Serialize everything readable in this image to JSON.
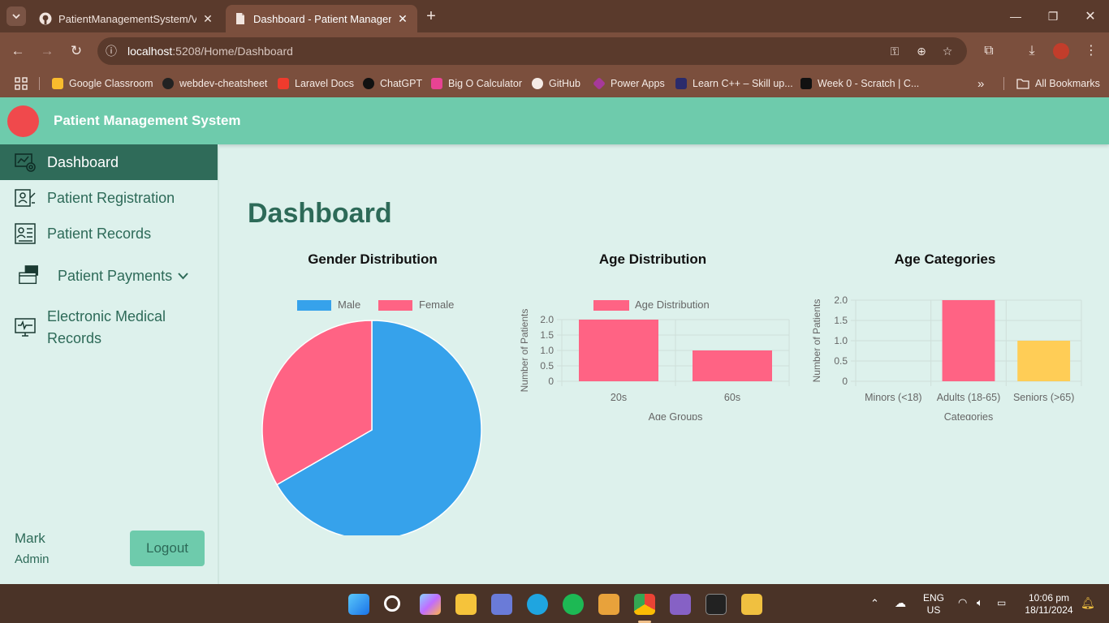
{
  "browser": {
    "tabs": [
      {
        "title": "PatientManagementSystem/Vie",
        "active": false
      },
      {
        "title": "Dashboard - Patient Manageme",
        "active": true
      }
    ],
    "url_host": "localhost",
    "url_path": ":5208/Home/Dashboard",
    "bookmarks": [
      {
        "label": "Google Classroom",
        "color": "#f9bb2d"
      },
      {
        "label": "webdev-cheatsheet",
        "color": "#222222"
      },
      {
        "label": "Laravel Docs",
        "color": "#ef3b2d"
      },
      {
        "label": "ChatGPT",
        "color": "#111111"
      },
      {
        "label": "Big O Calculator",
        "color": "#e84393"
      },
      {
        "label": "GitHub",
        "color": "#111111"
      },
      {
        "label": "Power Apps",
        "color": "#742774"
      },
      {
        "label": "Learn C++ – Skill up...",
        "color": "#2b2b6b"
      },
      {
        "label": "Week 0 - Scratch | C...",
        "color": "#111111"
      }
    ],
    "all_bookmarks": "All Bookmarks"
  },
  "app": {
    "title": "Patient Management System",
    "nav": [
      {
        "label": "Dashboard",
        "active": true
      },
      {
        "label": "Patient Registration",
        "active": false
      },
      {
        "label": "Patient Records",
        "active": false
      },
      {
        "label": "Patient Payments",
        "active": false
      },
      {
        "label": "Electronic Medical",
        "active": false
      },
      {
        "label": "Records",
        "active": false
      }
    ],
    "user": {
      "name": "Mark",
      "role": "Admin"
    },
    "logout_label": "Logout",
    "page_title": "Dashboard"
  },
  "colors": {
    "pink": "#ff6384",
    "blue": "#36a2eb",
    "yellow": "#ffcd56",
    "accent": "#6ecbac",
    "dark": "#2f6b59"
  },
  "chart_data": [
    {
      "type": "pie",
      "title": "Gender Distribution",
      "categories": [
        "Male",
        "Female"
      ],
      "values": [
        2,
        1
      ],
      "colors": [
        "#36a2eb",
        "#ff6384"
      ],
      "legend": "top"
    },
    {
      "type": "bar",
      "title": "Age Distribution",
      "categories": [
        "20s",
        "60s"
      ],
      "series": [
        {
          "name": "Age Distribution",
          "values": [
            2,
            1
          ]
        }
      ],
      "xlabel": "Age Groups",
      "ylabel": "Number of Patients",
      "ylim": [
        0,
        2
      ],
      "yticks": [
        "0",
        "0.5",
        "1.0",
        "1.5",
        "2.0"
      ],
      "legend": "top"
    },
    {
      "type": "bar",
      "title": "Age Categories",
      "categories": [
        "Minors (<18)",
        "Adults (18-65)",
        "Seniors (>65)"
      ],
      "values": [
        0,
        2,
        1
      ],
      "colors": [
        "#36a2eb",
        "#ff6384",
        "#ffcd56"
      ],
      "xlabel": "Categories",
      "ylabel": "Number of Patients",
      "ylim": [
        0,
        2
      ],
      "yticks": [
        "0",
        "0.5",
        "1.0",
        "1.5",
        "2.0"
      ]
    }
  ],
  "taskbar": {
    "lang": "ENG",
    "region": "US",
    "time": "10:06 pm",
    "date": "18/11/2024"
  }
}
